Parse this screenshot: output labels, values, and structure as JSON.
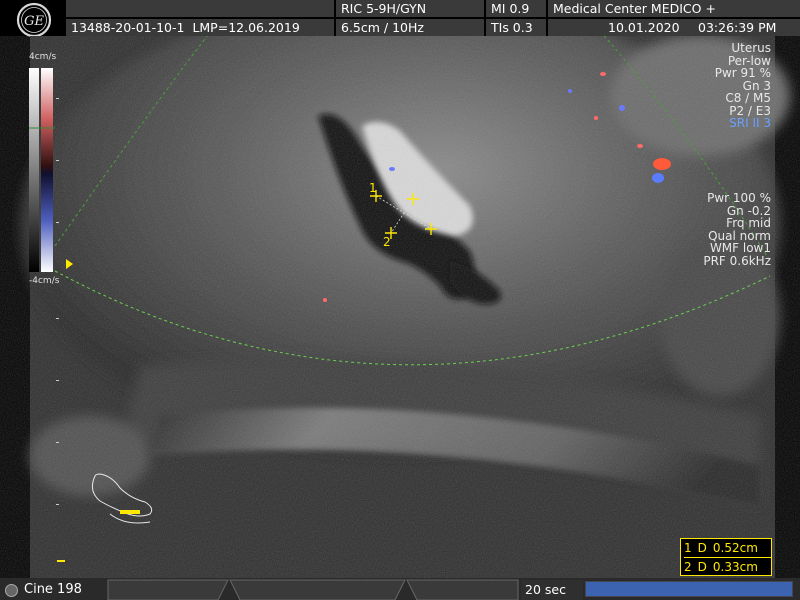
{
  "header": {
    "patient_id": "13488-20-01-10-1",
    "lmp": "LMP=12.06.2019",
    "probe": "RIC 5-9H/GYN",
    "depth_freq": "6.5cm / 10Hz",
    "mi": "MI  0.9",
    "tis": "TIs  0.3",
    "center": "Medical Center MEDICO +",
    "date": "10.01.2020",
    "time": "03:26:39 PM"
  },
  "logo": {
    "icon": "ge-logo-icon"
  },
  "colorbar": {
    "top_label": "4cm/s",
    "bottom_label": "-4cm/s"
  },
  "params_top": [
    "Uterus",
    "Per-low",
    "Pwr  91 %",
    "Gn  3",
    "C8 / M5",
    "P2 / E3",
    "SRI II 3"
  ],
  "params_doppler": [
    "Pwr 100 %",
    "Gn -0.2",
    "Frq mid",
    "Qual norm",
    "WMF low1",
    "PRF  0.6kHz"
  ],
  "measurements": [
    {
      "index": "1",
      "label": "D",
      "value": "0.52cm"
    },
    {
      "index": "2",
      "label": "D",
      "value": "0.33cm"
    }
  ],
  "caliper_labels": {
    "first": "1",
    "second": "2"
  },
  "bottom": {
    "cine": "Cine 198",
    "seconds": "20 sec",
    "progress": 1.0
  },
  "colors": {
    "accent_yellow": "#ffe800",
    "header_bg": "#3a3a3a",
    "sri_blue": "#6aa0ff",
    "progress_blue": "#3c63b0"
  }
}
